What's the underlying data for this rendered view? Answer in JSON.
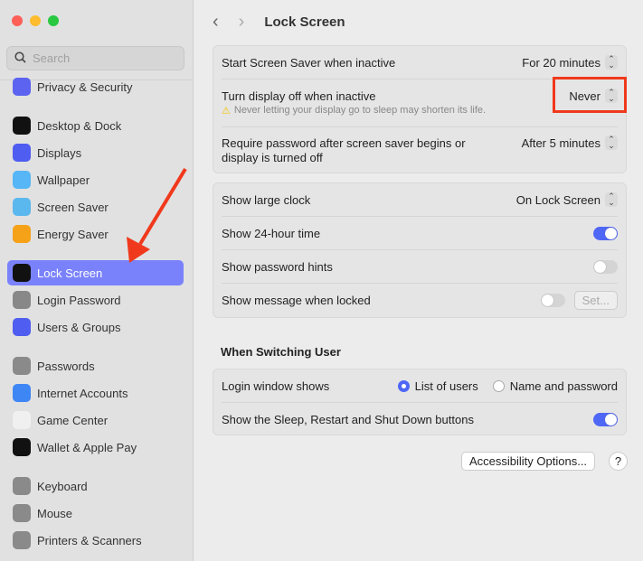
{
  "window": {
    "title": "Lock Screen"
  },
  "search": {
    "placeholder": "Search"
  },
  "sidebar": {
    "items": [
      {
        "label": "Privacy & Security",
        "icon": "hand-icon",
        "color": "#5b63f0"
      },
      {
        "label": "Desktop & Dock",
        "icon": "dock-icon",
        "color": "#111111"
      },
      {
        "label": "Displays",
        "icon": "sun-icon",
        "color": "#4f5df0"
      },
      {
        "label": "Wallpaper",
        "icon": "flower-icon",
        "color": "#57b6f5"
      },
      {
        "label": "Screen Saver",
        "icon": "screen-saver-icon",
        "color": "#5bb8ee"
      },
      {
        "label": "Energy Saver",
        "icon": "lightbulb-icon",
        "color": "#f5a218"
      },
      {
        "label": "Lock Screen",
        "icon": "lock-icon",
        "color": "#111111"
      },
      {
        "label": "Login Password",
        "icon": "lock-icon",
        "color": "#888888"
      },
      {
        "label": "Users & Groups",
        "icon": "users-icon",
        "color": "#4f5df0"
      },
      {
        "label": "Passwords",
        "icon": "key-icon",
        "color": "#8a8a8a"
      },
      {
        "label": "Internet Accounts",
        "icon": "at-icon",
        "color": "#3f86f5"
      },
      {
        "label": "Game Center",
        "icon": "game-center-icon",
        "color": "#f0f0f0"
      },
      {
        "label": "Wallet & Apple Pay",
        "icon": "wallet-icon",
        "color": "#111111"
      },
      {
        "label": "Keyboard",
        "icon": "keyboard-icon",
        "color": "#8a8a8a"
      },
      {
        "label": "Mouse",
        "icon": "mouse-icon",
        "color": "#8a8a8a"
      },
      {
        "label": "Printers & Scanners",
        "icon": "printer-icon",
        "color": "#8a8a8a"
      }
    ]
  },
  "main": {
    "card1": {
      "screen_saver_label": "Start Screen Saver when inactive",
      "screen_saver_value": "For 20 minutes",
      "display_off_label": "Turn display off when inactive",
      "display_off_value": "Never",
      "warning": "Never letting your display go to sleep may shorten its life.",
      "require_pw_label_1": "Require password after screen saver begins or",
      "require_pw_label_2": "display is turned off",
      "require_pw_value": "After 5 minutes"
    },
    "card2": {
      "large_clock_label": "Show large clock",
      "large_clock_value": "On Lock Screen",
      "time24_label": "Show 24-hour time",
      "time24_on": true,
      "hints_label": "Show password hints",
      "hints_on": false,
      "message_label": "Show message when locked",
      "message_on": false,
      "set_button": "Set..."
    },
    "switching_heading": "When Switching User",
    "card3": {
      "login_window_label": "Login window shows",
      "option_list": "List of users",
      "option_name": "Name and password",
      "selected": "List of users",
      "sleep_buttons_label": "Show the Sleep, Restart and Shut Down buttons",
      "sleep_buttons_on": true
    },
    "accessibility_button": "Accessibility Options...",
    "help_button": "?"
  },
  "colors": {
    "accent": "#4f67f5",
    "annotation": "#f0391c",
    "selection": "#7a82fb"
  }
}
